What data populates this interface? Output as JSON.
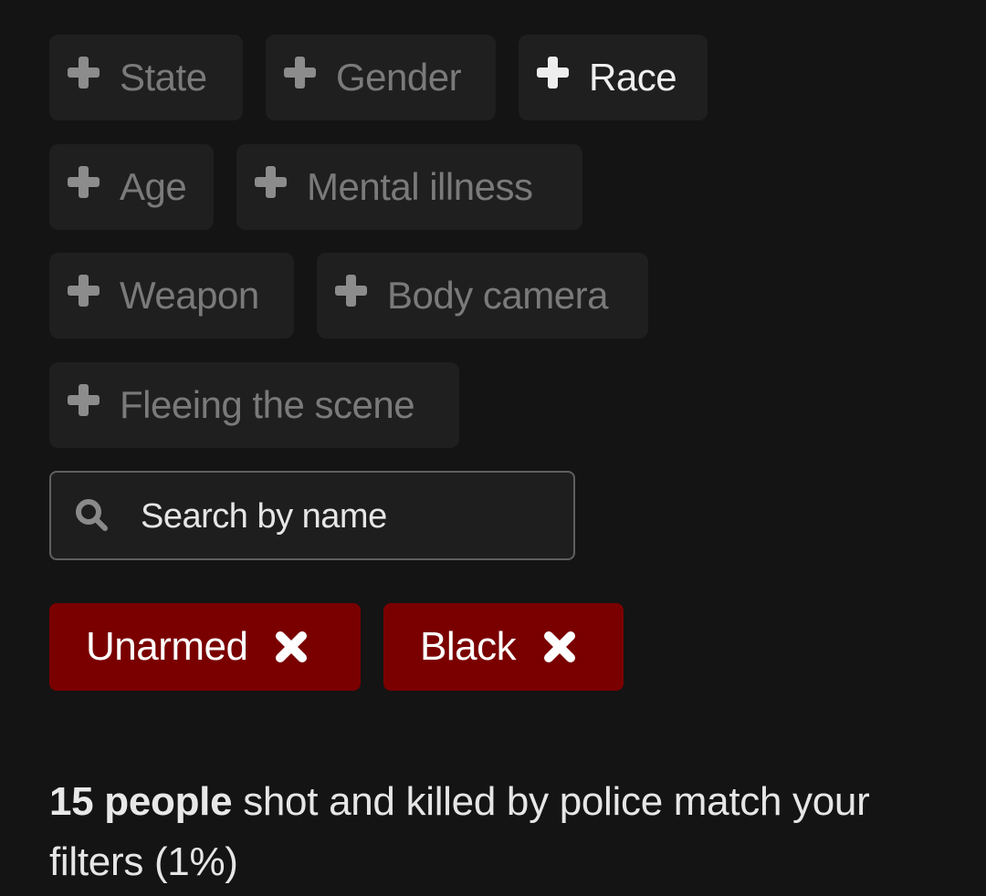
{
  "filters": [
    {
      "label": "State",
      "icon": "plus-icon",
      "active": false
    },
    {
      "label": "Gender",
      "icon": "plus-icon",
      "active": false
    },
    {
      "label": "Race",
      "icon": "plus-icon",
      "active": true
    },
    {
      "label": "Age",
      "icon": "plus-icon",
      "active": false
    },
    {
      "label": "Mental illness",
      "icon": "plus-icon",
      "active": false
    },
    {
      "label": "Weapon",
      "icon": "plus-icon",
      "active": false
    },
    {
      "label": "Body camera",
      "icon": "plus-icon",
      "active": false
    },
    {
      "label": "Fleeing the scene",
      "icon": "plus-icon",
      "active": false
    }
  ],
  "search": {
    "icon": "search-icon",
    "placeholder": "Search by name",
    "value": ""
  },
  "active_tags": [
    {
      "label": "Unarmed",
      "icon": "close-icon"
    },
    {
      "label": "Black",
      "icon": "close-icon"
    }
  ],
  "result": {
    "count_label": "15 people",
    "text": " shot and killed by police match your filters (1%)"
  },
  "colors": {
    "background": "#141414",
    "chip_background": "#1f1f1f",
    "tag_background": "#7a0000",
    "inactive_text": "#7a7a7a",
    "active_text": "#efefef"
  }
}
